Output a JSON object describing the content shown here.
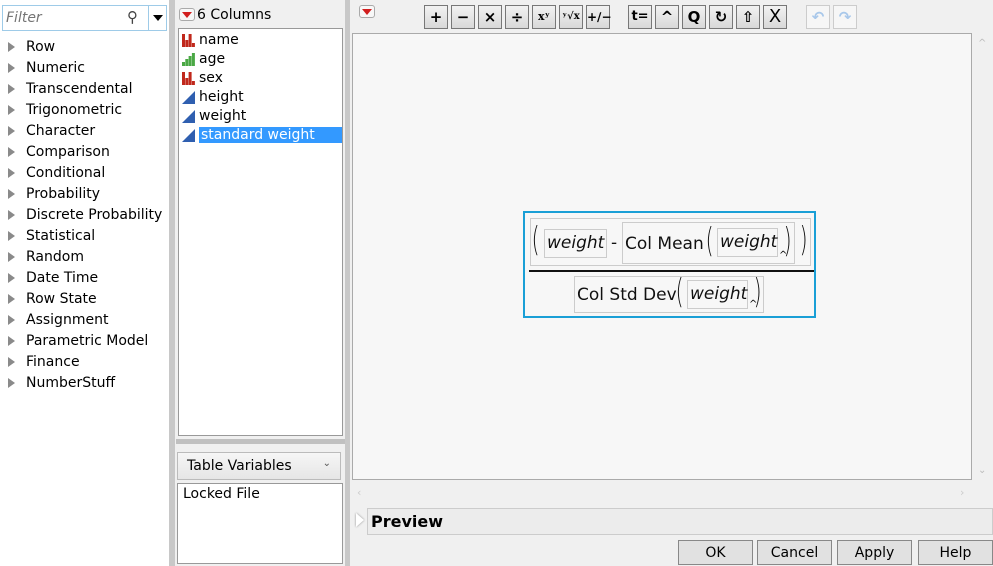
{
  "filter": {
    "placeholder": "Filter"
  },
  "categories": [
    "Row",
    "Numeric",
    "Transcendental",
    "Trigonometric",
    "Character",
    "Comparison",
    "Conditional",
    "Probability",
    "Discrete Probability",
    "Statistical",
    "Random",
    "Date Time",
    "Row State",
    "Assignment",
    "Parametric Model",
    "Finance",
    "NumberStuff"
  ],
  "columns": {
    "header": "6 Columns",
    "items": [
      {
        "name": "name",
        "type": "nominal"
      },
      {
        "name": "age",
        "type": "ordinal"
      },
      {
        "name": "sex",
        "type": "nominal"
      },
      {
        "name": "height",
        "type": "continuous"
      },
      {
        "name": "weight",
        "type": "continuous"
      },
      {
        "name": "standard weight",
        "type": "continuous",
        "selected": true
      }
    ]
  },
  "table_vars": {
    "label": "Table Variables",
    "items": [
      "Locked File"
    ]
  },
  "toolbar": {
    "plus": "+",
    "minus": "−",
    "times": "×",
    "divide": "÷",
    "power": "xʸ",
    "root": "ʸ√x",
    "plusminus": "+∕−",
    "assign": "t=",
    "caret": "^",
    "local": "Q",
    "loop": "↻",
    "push": "⇧",
    "delete": "X",
    "undo": "↶",
    "redo": "↷"
  },
  "formula": {
    "numerator_var": "weight",
    "minus": "-",
    "func1": "Col Mean",
    "func1_arg": "weight",
    "func2": "Col Std Dev",
    "func2_arg": "weight",
    "caret": "^"
  },
  "preview": {
    "label": "Preview"
  },
  "buttons": {
    "ok": "OK",
    "cancel": "Cancel",
    "apply": "Apply",
    "help": "Help"
  },
  "colors": {
    "accent": "#1a9fd6",
    "selection": "#3399ff",
    "nominal": "#c0281c",
    "ordinal": "#4aa845",
    "continuous": "#2f5fb0"
  }
}
